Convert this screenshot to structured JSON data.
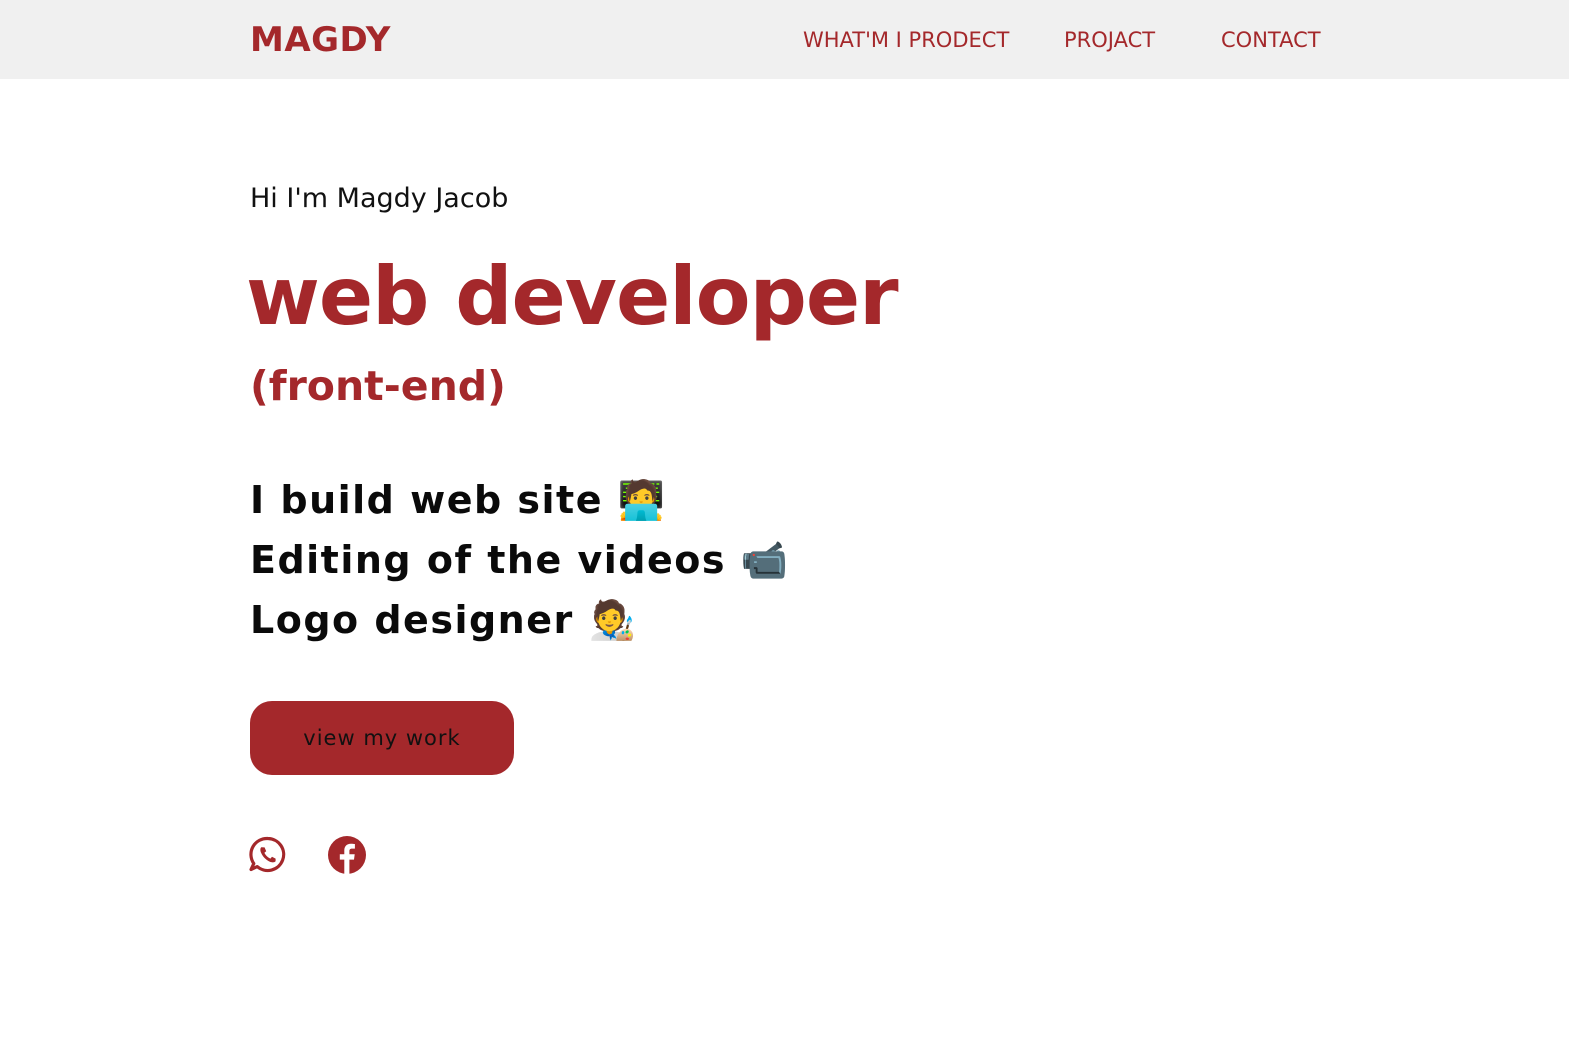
{
  "header": {
    "brand": "MAGDY",
    "nav": [
      "WHAT'M I PRODECT",
      "PROJACT",
      "CONTACT"
    ]
  },
  "hero": {
    "greeting": "Hi I'm Magdy Jacob",
    "role": "web developer",
    "role_sub": "(front-end)",
    "skills": [
      {
        "text": "I build web site",
        "emoji": "🧑‍💻",
        "icon": "technologist-emoji"
      },
      {
        "text": "Editing of the videos",
        "emoji": "📹",
        "icon": "video-camera-emoji"
      },
      {
        "text": "Logo designer",
        "emoji": "🧑‍🎨",
        "icon": "artist-emoji"
      }
    ],
    "cta_label": "view my work"
  },
  "social": [
    {
      "icon": "whatsapp-icon"
    },
    {
      "icon": "facebook-icon"
    }
  ],
  "colors": {
    "accent": "#a4282b",
    "header_bg": "#f0f0f0",
    "text": "#111111"
  }
}
